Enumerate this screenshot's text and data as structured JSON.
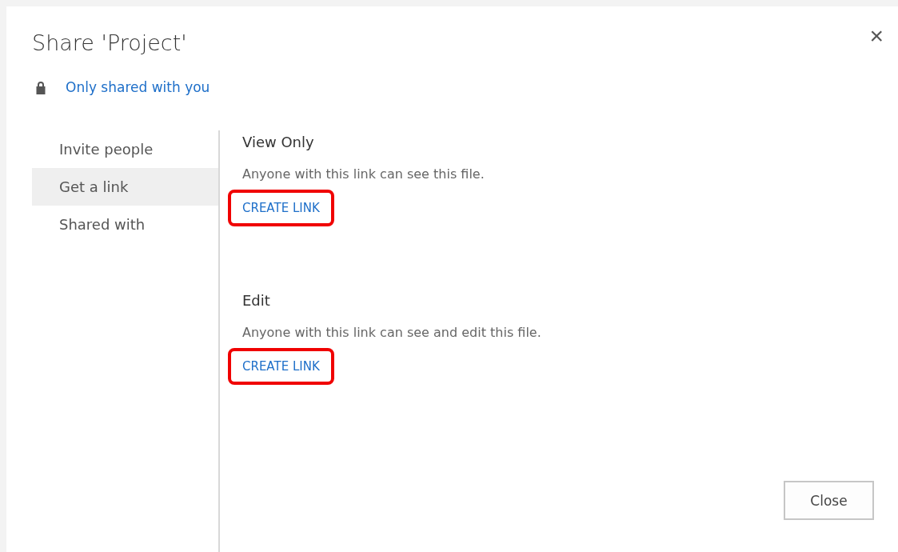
{
  "dialog": {
    "title": "Share 'Project'",
    "close_icon": "×"
  },
  "access": {
    "label": "Only shared with you"
  },
  "nav": [
    {
      "label": "Invite people",
      "selected": false
    },
    {
      "label": "Get a link",
      "selected": true
    },
    {
      "label": "Shared with",
      "selected": false
    }
  ],
  "links": [
    {
      "heading": "View Only",
      "description": "Anyone with this link can see this file.",
      "action": "CREATE LINK",
      "highlighted": true
    },
    {
      "heading": "Edit",
      "description": "Anyone with this link can see and edit this file.",
      "action": "CREATE LINK",
      "highlighted": true
    }
  ],
  "buttons": [
    "Close"
  ]
}
